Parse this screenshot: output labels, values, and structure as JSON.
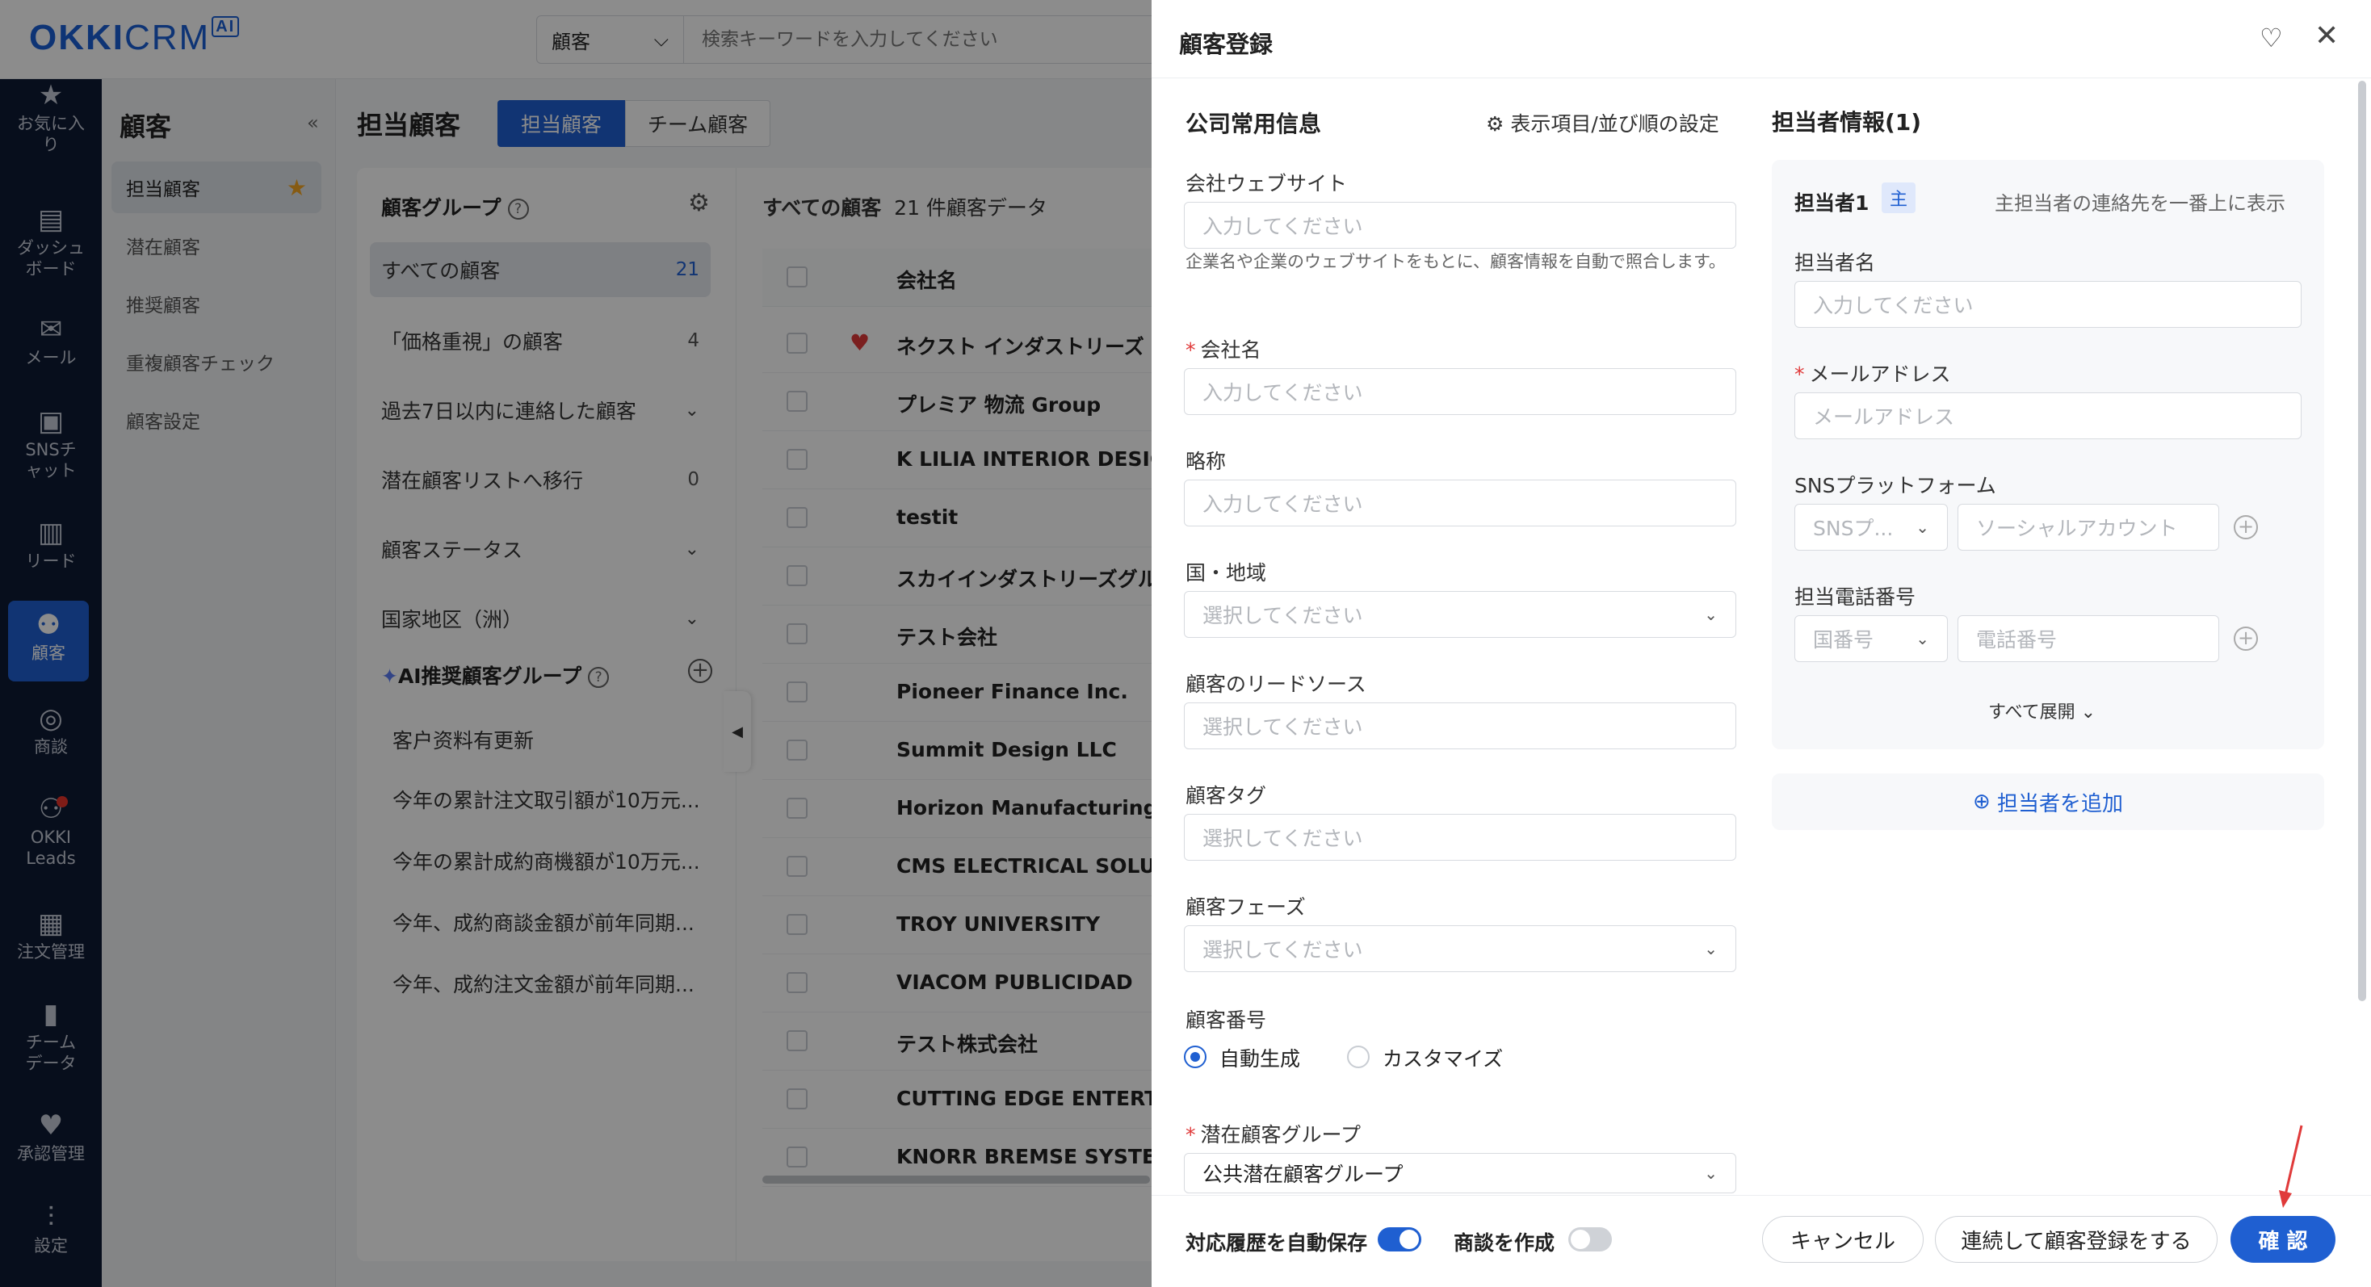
{
  "app": {
    "logo_main": "OKKI",
    "logo_crm": "CRM",
    "logo_ai": "AI"
  },
  "search": {
    "type": "顧客",
    "placeholder": "検索キーワードを入力してください"
  },
  "nav": [
    {
      "label": "お気に入り",
      "icon": "star-icon"
    },
    {
      "label": "ダッシュボード",
      "icon": "dashboard-icon"
    },
    {
      "label": "メール",
      "icon": "mail-icon"
    },
    {
      "label": "SNSチャット",
      "icon": "chat-icon"
    },
    {
      "label": "リード",
      "icon": "lead-icon"
    },
    {
      "label": "顧客",
      "icon": "customer-icon"
    },
    {
      "label": "商談",
      "icon": "target-icon"
    },
    {
      "label": "OKKI Leads",
      "icon": "okki-leads-icon"
    },
    {
      "label": "注文管理",
      "icon": "order-icon"
    },
    {
      "label": "チームデータ",
      "icon": "chart-icon"
    },
    {
      "label": "承認管理",
      "icon": "handshake-icon"
    },
    {
      "label": "設定",
      "icon": "settings-icon"
    }
  ],
  "subside": {
    "title": "顧客",
    "items": [
      "担当顧客",
      "潜在顧客",
      "推奨顧客",
      "重複顧客チェック",
      "顧客設定"
    ]
  },
  "main": {
    "title": "担当顧客",
    "tabs": [
      "担当顧客",
      "チーム顧客"
    ],
    "group_title": "顧客グループ",
    "groups": [
      {
        "label": "すべての顧客",
        "count": "21"
      },
      {
        "label": "「価格重視」の顧客",
        "count": "4"
      },
      {
        "label": "過去7日以内に連絡した顧客",
        "count": ""
      },
      {
        "label": "潜在顧客リストへ移行",
        "count": "0"
      },
      {
        "label": "顧客ステータス",
        "count": ""
      },
      {
        "label": "国家地区（洲）",
        "count": ""
      }
    ],
    "ai_group_title": "AI推奨顧客グループ",
    "ai_groups": [
      "客户资料有更新",
      "今年の累計注文取引額が10万元...",
      "今年の累計成約商機額が10万元...",
      "今年、成約商談金額が前年同期...",
      "今年、成約注文金額が前年同期..."
    ],
    "list_head_bold": "すべての顧客",
    "list_head_count": "21 件顧客データ",
    "column_name": "会社名",
    "rows": [
      "ネクスト インダストリーズ",
      "プレミア 物流 Group",
      "K LILIA INTERIOR DESIGN",
      "testit",
      "スカイインダストリーズグル",
      "テスト会社",
      "Pioneer Finance Inc.",
      "Summit Design LLC",
      "Horizon Manufacturing Inc",
      "CMS ELECTRICAL SOLUTIONS",
      "TROY UNIVERSITY",
      "VIACOM PUBLICIDAD",
      "テスト株式会社",
      "CUTTING EDGE ENTERTAIN",
      "KNORR BREMSE SYSTEMS"
    ]
  },
  "drawer": {
    "title": "顧客登録",
    "company_section": "公司常用信息",
    "settings_link": "表示項目/並び順の設定",
    "fields": {
      "website_label": "会社ウェブサイト",
      "website_ph": "入力してください",
      "website_hint": "企業名や企業のウェブサイトをもとに、顧客情報を自動で照合します。",
      "name_label": "会社名",
      "name_ph": "入力してください",
      "short_label": "略称",
      "short_ph": "入力してください",
      "country_label": "国・地域",
      "country_ph": "選択してください",
      "source_label": "顧客のリードソース",
      "source_ph": "選択してください",
      "tag_label": "顧客タグ",
      "tag_ph": "選択してください",
      "phase_label": "顧客フェーズ",
      "phase_ph": "選択してください",
      "number_label": "顧客番号",
      "number_auto": "自動生成",
      "number_custom": "カスタマイズ",
      "pool_label": "潜在顧客グループ",
      "pool_value": "公共潜在顧客グループ"
    },
    "contact_section": "担当者情報(1)",
    "contact": {
      "title": "担当者1",
      "badge": "主",
      "hint": "主担当者の連絡先を一番上に表示",
      "name_label": "担当者名",
      "name_ph": "入力してください",
      "email_label": "メールアドレス",
      "email_ph": "メールアドレス",
      "sns_label": "SNSプラットフォーム",
      "sns_ph": "SNSプ...",
      "sns_account_ph": "ソーシャルアカウント",
      "phone_label": "担当電話番号",
      "phone_code_ph": "国番号",
      "phone_ph": "電話番号",
      "expand": "すべて展開",
      "add": "担当者を追加"
    },
    "footer": {
      "autosave_label": "対応履歴を自動保存",
      "deal_label": "商談を作成",
      "cancel": "キャンセル",
      "continue": "連続して顧客登録をする",
      "confirm": "確 認"
    }
  },
  "colors": {
    "accent": "#1f5fd1",
    "nav_bg": "#0e1a33",
    "required": "#e03a3a",
    "annotation_arrow": "#e03a3a"
  }
}
